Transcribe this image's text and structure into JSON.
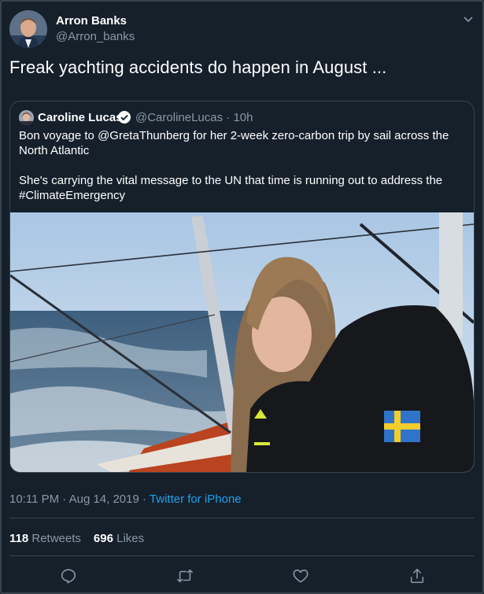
{
  "author": {
    "name": "Arron Banks",
    "handle": "@Arron_banks"
  },
  "tweet": {
    "text": "Freak yachting accidents do happen in August ..."
  },
  "quoted_tweet": {
    "name": "Caroline Lucas",
    "handle_time": "@CarolineLucas · 10h",
    "paragraph_1": "Bon voyage to @GretaThunberg for her 2-week zero-carbon trip by sail across the North Atlantic",
    "paragraph_2": "She's carrying the vital message to the UN that time is running out to address the #ClimateEmergency"
  },
  "meta": {
    "timestamp": "10:11 PM · Aug 14, 2019 · ",
    "source": "Twitter for iPhone"
  },
  "stats": {
    "retweets_count": "118",
    "retweets_label": "Retweets",
    "likes_count": "696",
    "likes_label": "Likes"
  },
  "icons": [
    "caret-down-icon",
    "verified-badge-icon",
    "reply-icon",
    "retweet-icon",
    "like-icon",
    "share-icon"
  ],
  "colors": {
    "background": "#15202b",
    "border": "#38444d",
    "secondary_text": "#8899a6",
    "link": "#1da1f2"
  }
}
